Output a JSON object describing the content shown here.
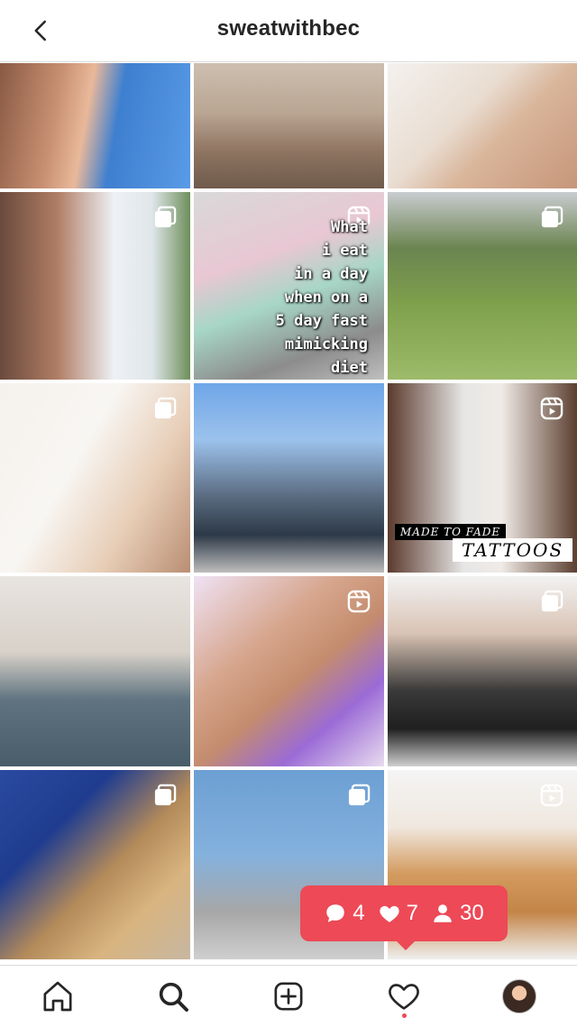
{
  "header": {
    "title": "sweatwithbec",
    "back_icon": "chevron-left-icon"
  },
  "grid": {
    "tiles": [
      {
        "name": "selfie-sky",
        "badge": "none",
        "bg": "linear-gradient(100deg,#8a5a44 0%,#c89073 30%,#e9b89a 45%,#3e7fd0 60%,#5a9be6 100%)"
      },
      {
        "name": "beach-pose",
        "badge": "none",
        "bg": "linear-gradient(180deg,#cdbfb0 0%,#b9a592 40%,#8f7562 70%,#6f5a4b 100%)"
      },
      {
        "name": "nails-gold",
        "badge": "none",
        "bg": "linear-gradient(135deg,#f4f1ee 0%,#e9ddd2 40%,#d9b59a 60%,#c6967a 100%)"
      },
      {
        "name": "portrait-bandage",
        "badge": "carousel",
        "bg": "linear-gradient(90deg,#6a4a3e 0%,#b07d64 30%,#eef1f5 60%,#dfe6ea 80%,#6e8f5a 100%)"
      },
      {
        "name": "what-i-eat",
        "badge": "reel",
        "bg": "linear-gradient(160deg,#d9d9d9 0%,#e8c7d3 35%,#a7d6c7 55%,#8c8c8c 80%,#bfbfbf 100%)"
      },
      {
        "name": "grass-dog",
        "badge": "carousel",
        "bg": "linear-gradient(180deg,#c9ccd0 0%,#6b8450 30%,#7fa04c 60%,#9dbb6a 100%)"
      },
      {
        "name": "crop-top",
        "badge": "carousel",
        "bg": "linear-gradient(120deg,#f5f1ec 0%,#f8f6f3 40%,#e7cdb6 70%,#b98e72 100%)"
      },
      {
        "name": "outdoor-stance",
        "badge": "none",
        "bg": "linear-gradient(180deg,#6fa6e8 0%,#9cc2ec 30%,#5a6b80 60%,#2d3947 80%,#bdbdbd 100%)"
      },
      {
        "name": "made-to-fade",
        "badge": "reel",
        "bg": "linear-gradient(90deg,#5b3a2c 0%,#e6e6e6 40%,#f0ebe6 60%,#5b3f30 100%)"
      },
      {
        "name": "mirror-bed",
        "badge": "none",
        "bg": "linear-gradient(180deg,#e8e4e0 0%,#d8d1c9 40%,#5f7480 65%,#485d69 100%)"
      },
      {
        "name": "purple-nails",
        "badge": "reel",
        "bg": "linear-gradient(140deg,#efe2f4 0%,#d6a58c 35%,#c48c6e 55%,#9b6bd6 75%,#e8dcef 100%)"
      },
      {
        "name": "group-photo",
        "badge": "carousel",
        "bg": "linear-gradient(180deg,#f2f2f2 0%,#d9c3b4 30%,#3a3a3a 60%,#1f1f1f 80%,#cfcfcf 100%)"
      },
      {
        "name": "slides-table",
        "badge": "carousel",
        "bg": "linear-gradient(135deg,#2a4aa0 0%,#1f3c8f 30%,#b38a5a 55%,#d8b47f 75%,#c7b7a1 100%)"
      },
      {
        "name": "yoga-wall",
        "badge": "carousel",
        "bg": "linear-gradient(180deg,#6c9fd3 0%,#84b1dd 45%,#a7a7a7 75%,#cfcfcf 100%)"
      },
      {
        "name": "pomeranian",
        "badge": "reel",
        "bg": "linear-gradient(180deg,#f4f4f4 0%,#f0e8df 30%,#d39a5e 55%,#c48548 75%,#efefef 100%)"
      }
    ],
    "overlay_text": "What\ni eat\nin a day\nwhen on a\n5 day fast\nmimicking\ndiet",
    "tattoo_top": "MADE TO FADE",
    "tattoo_bottom": "TATTOOS"
  },
  "notification": {
    "comments": "4",
    "likes": "7",
    "followers": "30",
    "color": "#ed4956"
  },
  "tabbar": {
    "items": [
      "home-icon",
      "search-icon",
      "add-post-icon",
      "heart-icon",
      "profile-avatar"
    ]
  }
}
